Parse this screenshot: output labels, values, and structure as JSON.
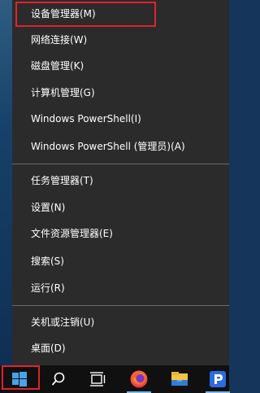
{
  "menu": {
    "items": [
      {
        "label": "设备管理器(M)"
      },
      {
        "label": "网络连接(W)"
      },
      {
        "label": "磁盘管理(K)"
      },
      {
        "label": "计算机管理(G)"
      },
      {
        "label": "Windows PowerShell(I)"
      },
      {
        "label": "Windows PowerShell (管理员)(A)"
      },
      {
        "label": "任务管理器(T)"
      },
      {
        "label": "设置(N)"
      },
      {
        "label": "文件资源管理器(E)"
      },
      {
        "label": "搜索(S)"
      },
      {
        "label": "运行(R)"
      },
      {
        "label": "关机或注销(U)"
      },
      {
        "label": "桌面(D)"
      }
    ],
    "highlighted_item": "设备管理器(M)",
    "highlight_color": "#e0222f"
  },
  "taskbar": {
    "icons": [
      "windows-start-icon",
      "search-icon",
      "task-view-icon",
      "firefox-icon",
      "file-explorer-icon",
      "app-icon"
    ],
    "accent_color": "#76b9ed"
  }
}
